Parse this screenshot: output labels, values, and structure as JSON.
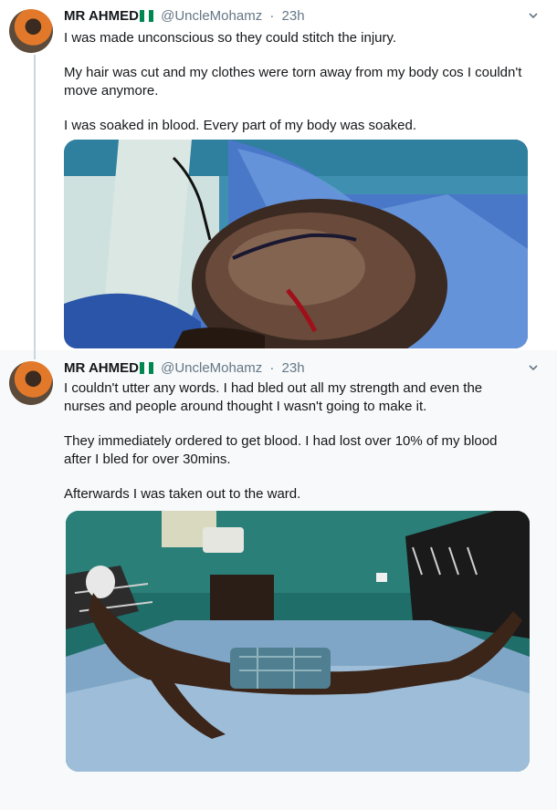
{
  "tweets": [
    {
      "author_name": "MR AHMED",
      "handle": "@UncleMohamz",
      "separator": "·",
      "time": "23h",
      "paragraphs": [
        "I was made unconscious so they could stitch the injury.",
        "My hair was cut and my clothes were torn away from my body cos I couldn't move anymore.",
        "I was soaked in blood. Every part of my body was soaked."
      ],
      "media_icon": "photo-wound-stitches"
    },
    {
      "author_name": "MR AHMED",
      "handle": "@UncleMohamz",
      "separator": "·",
      "time": "23h",
      "paragraphs": [
        "I couldn't utter any words. I had bled out all my strength and even the nurses and people around thought I wasn't going to make it.",
        "They immediately ordered to get blood. I had lost over 10% of my blood after I bled for over 30mins.",
        "Afterwards I was taken out to the ward."
      ],
      "media_icon": "photo-hospital-ward"
    }
  ],
  "colors": {
    "flag_green": "#008751",
    "flag_white": "#ffffff",
    "thread_line": "#ccd6dd",
    "secondary_text": "#657786",
    "selected_background": "#f7f9fa"
  },
  "icons": {
    "caret": "chevron-down-icon",
    "flag": "nigeria-flag-icon"
  }
}
